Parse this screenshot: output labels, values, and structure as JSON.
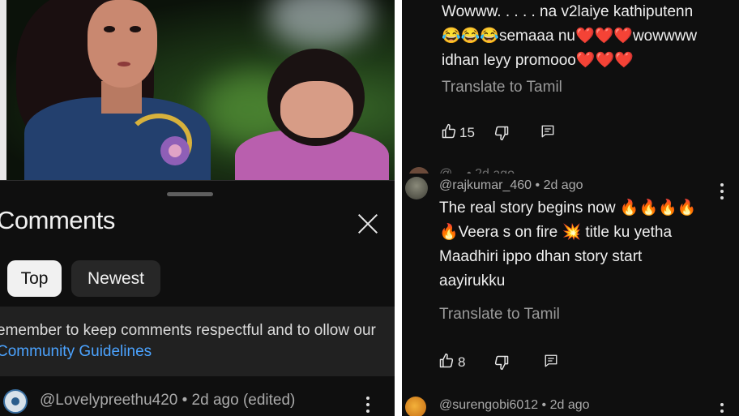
{
  "sheet": {
    "title": "Comments",
    "filters": {
      "top": "Top",
      "newest": "Newest"
    },
    "notice_text": "emember to keep comments respectful and to ollow our",
    "notice_link": "Community Guidelines"
  },
  "left_comment": {
    "meta": "@Lovelypreethu420 • 2d ago (edited)"
  },
  "right_comments": [
    {
      "lines": [
        "Wowww. . . . . na v2laiye kathiputenn",
        "😂😂😂semaaa nu❤️❤️❤️wowwww",
        "idhan leyy promooo❤️❤️❤️"
      ],
      "translate": "Translate to Tamil",
      "likes": "15"
    },
    {
      "partial_meta": "@... • 2d ago",
      "meta": "@rajkumar_460 • 2d ago",
      "lines": [
        "The real story begins now 🔥🔥🔥🔥",
        "🔥Veera s on fire 💥 title ku yetha",
        "Maadhiri ippo dhan story start",
        "aayirukku"
      ],
      "translate": "Translate to Tamil",
      "likes": "8"
    },
    {
      "meta": "@surengobi6012 • 2d ago"
    }
  ],
  "colors": {
    "background": "#0f0f0f",
    "link": "#4ba3ff",
    "chip_active": "#f1f1f1"
  }
}
